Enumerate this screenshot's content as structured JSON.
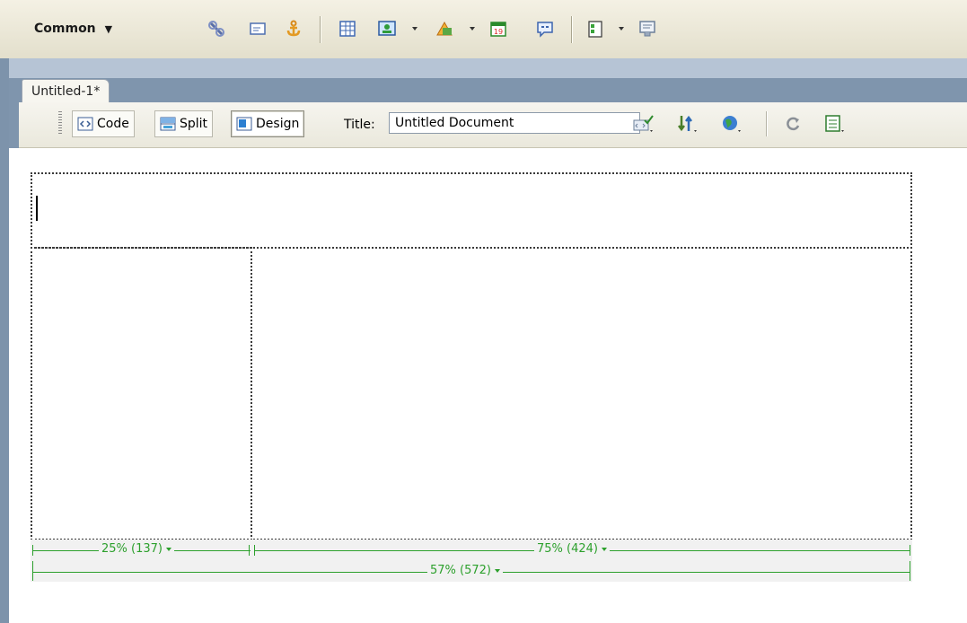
{
  "insert_bar": {
    "category": "Common",
    "icons": [
      "hyperlink-icon",
      "email-link-icon",
      "named-anchor-icon",
      "table-icon",
      "image-icon",
      "media-icon",
      "date-icon",
      "comment-icon",
      "templates-icon",
      "tag-chooser-icon"
    ]
  },
  "document": {
    "tab_label": "Untitled-1*",
    "views": {
      "code": "Code",
      "split": "Split",
      "design": "Design",
      "active": "Design"
    },
    "title_label": "Title:",
    "title_value": "Untitled Document"
  },
  "width_indicators": {
    "left_column": "25% (137)",
    "right_column": "75% (424)",
    "table": "57% (572)"
  },
  "colors": {
    "guide_green": "#2ca02c",
    "frame_blue": "#7f95ad"
  }
}
